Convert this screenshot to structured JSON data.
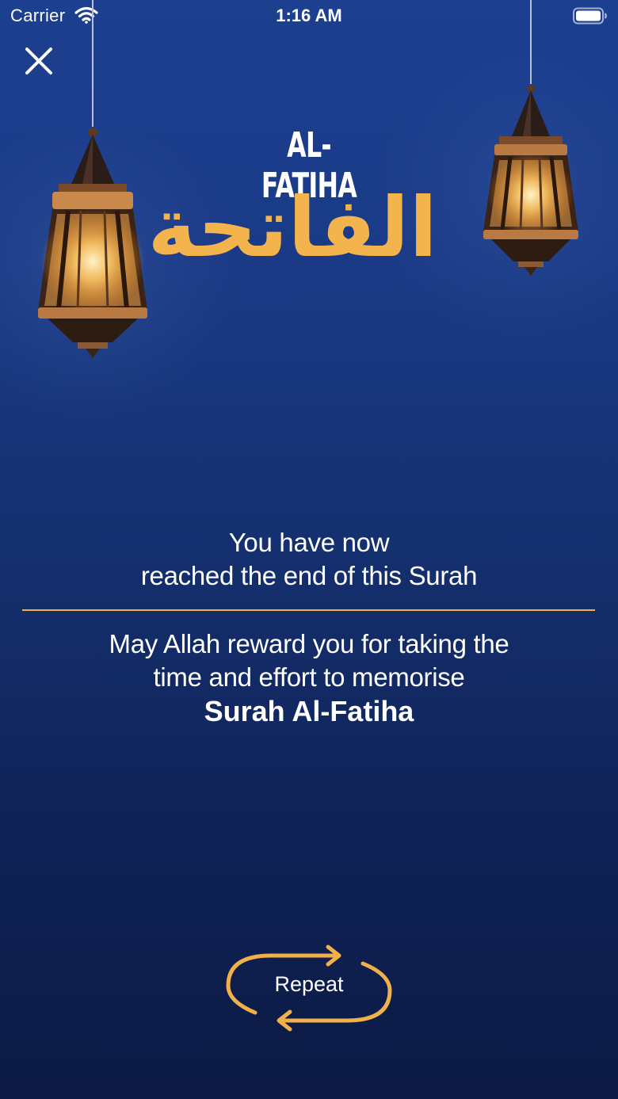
{
  "status_bar": {
    "carrier": "Carrier",
    "time": "1:16 AM"
  },
  "title": {
    "latin": "AL-FATIHA",
    "arabic": "الفاتحة"
  },
  "messages": {
    "end_line1": "You have now",
    "end_line2": "reached the end of this Surah",
    "reward_line1": "May Allah reward you for taking the",
    "reward_line2": "time and effort to memorise",
    "surah_name": "Surah Al-Fatiha"
  },
  "actions": {
    "repeat_label": "Repeat"
  },
  "colors": {
    "accent": "#f2b04a",
    "background_top": "#1c3f8f",
    "background_bottom": "#0c1a44"
  },
  "icons": {
    "close": "close-icon",
    "wifi": "wifi-icon",
    "battery": "battery-icon",
    "repeat": "repeat-arrows-icon",
    "lantern": "lantern-icon"
  }
}
